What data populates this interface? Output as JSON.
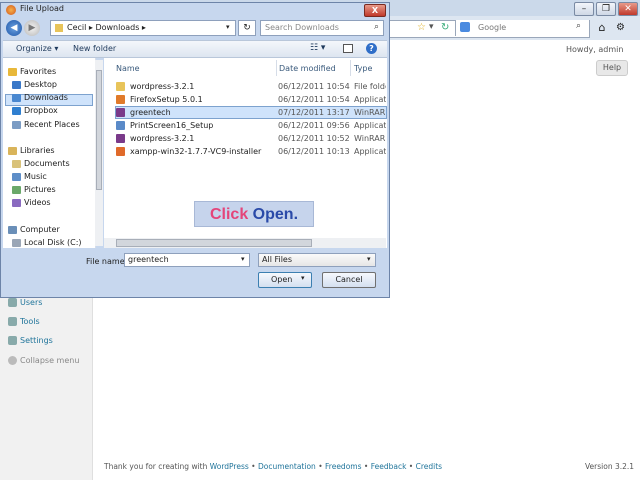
{
  "browser": {
    "address_search": "Google",
    "howdy": "Howdy, admin",
    "help": "Help"
  },
  "wp_sidebar": {
    "items": [
      {
        "label": "Users"
      },
      {
        "label": "Tools"
      },
      {
        "label": "Settings"
      },
      {
        "label": "Collapse menu"
      }
    ]
  },
  "footer": {
    "thanks": "Thank you for creating with ",
    "wp_link": "WordPress",
    "sep": " • ",
    "documentation": "Documentation",
    "freedoms": "Freedoms",
    "feedback": "Feedback",
    "credits": "Credits",
    "version": "Version 3.2.1"
  },
  "dialog": {
    "title": "File Upload",
    "path": "Cecil ▸ Downloads ▸",
    "search_placeholder": "Search Downloads",
    "toolbar": {
      "organize": "Organize ▾",
      "new_folder": "New folder"
    },
    "nav_tree": [
      {
        "label": "Favorites",
        "level": 0,
        "color": "#e8b83a"
      },
      {
        "label": "Desktop",
        "level": 1,
        "color": "#3a78c8"
      },
      {
        "label": "Downloads",
        "level": 1,
        "color": "#4a88d0"
      },
      {
        "label": "Dropbox",
        "level": 1,
        "color": "#2f7fd0"
      },
      {
        "label": "Recent Places",
        "level": 1,
        "color": "#7b9cc4"
      },
      {
        "label": "Libraries",
        "level": 0,
        "color": "#d9b45a"
      },
      {
        "label": "Documents",
        "level": 1,
        "color": "#d9c27a"
      },
      {
        "label": "Music",
        "level": 1,
        "color": "#5e8ec8"
      },
      {
        "label": "Pictures",
        "level": 1,
        "color": "#6aa86a"
      },
      {
        "label": "Videos",
        "level": 1,
        "color": "#8a6ac0"
      },
      {
        "label": "Computer",
        "level": 0,
        "color": "#6a8fb8"
      },
      {
        "label": "Local Disk (C:)",
        "level": 1,
        "color": "#9aa6b6"
      }
    ],
    "columns": {
      "name": "Name",
      "date": "Date modified",
      "type": "Type"
    },
    "files": [
      {
        "name": "wordpress-3.2.1",
        "date": "06/12/2011 10:54",
        "type": "File folder",
        "color": "#e8c45a"
      },
      {
        "name": "FirefoxSetup 5.0.1",
        "date": "06/12/2011 10:54",
        "type": "Application",
        "color": "#e07a2a"
      },
      {
        "name": "greentech",
        "date": "07/12/2011 13:17",
        "type": "WinRAR ZIP",
        "color": "#7a3a8a"
      },
      {
        "name": "PrintScreen16_Setup",
        "date": "06/12/2011 09:56",
        "type": "Application",
        "color": "#5a8ac8"
      },
      {
        "name": "wordpress-3.2.1",
        "date": "06/12/2011 10:52",
        "type": "WinRAR ZIP",
        "color": "#7a3a8a"
      },
      {
        "name": "xampp-win32-1.7.7-VC9-installer",
        "date": "06/12/2011 10:13",
        "type": "Application",
        "color": "#e06a2a"
      }
    ],
    "callout": {
      "part1": "Click ",
      "part2": "Open."
    },
    "filename_label": "File name:",
    "filename_value": "greentech",
    "filter": "All Files",
    "open_button": "Open",
    "cancel_button": "Cancel",
    "close_button": "X"
  }
}
